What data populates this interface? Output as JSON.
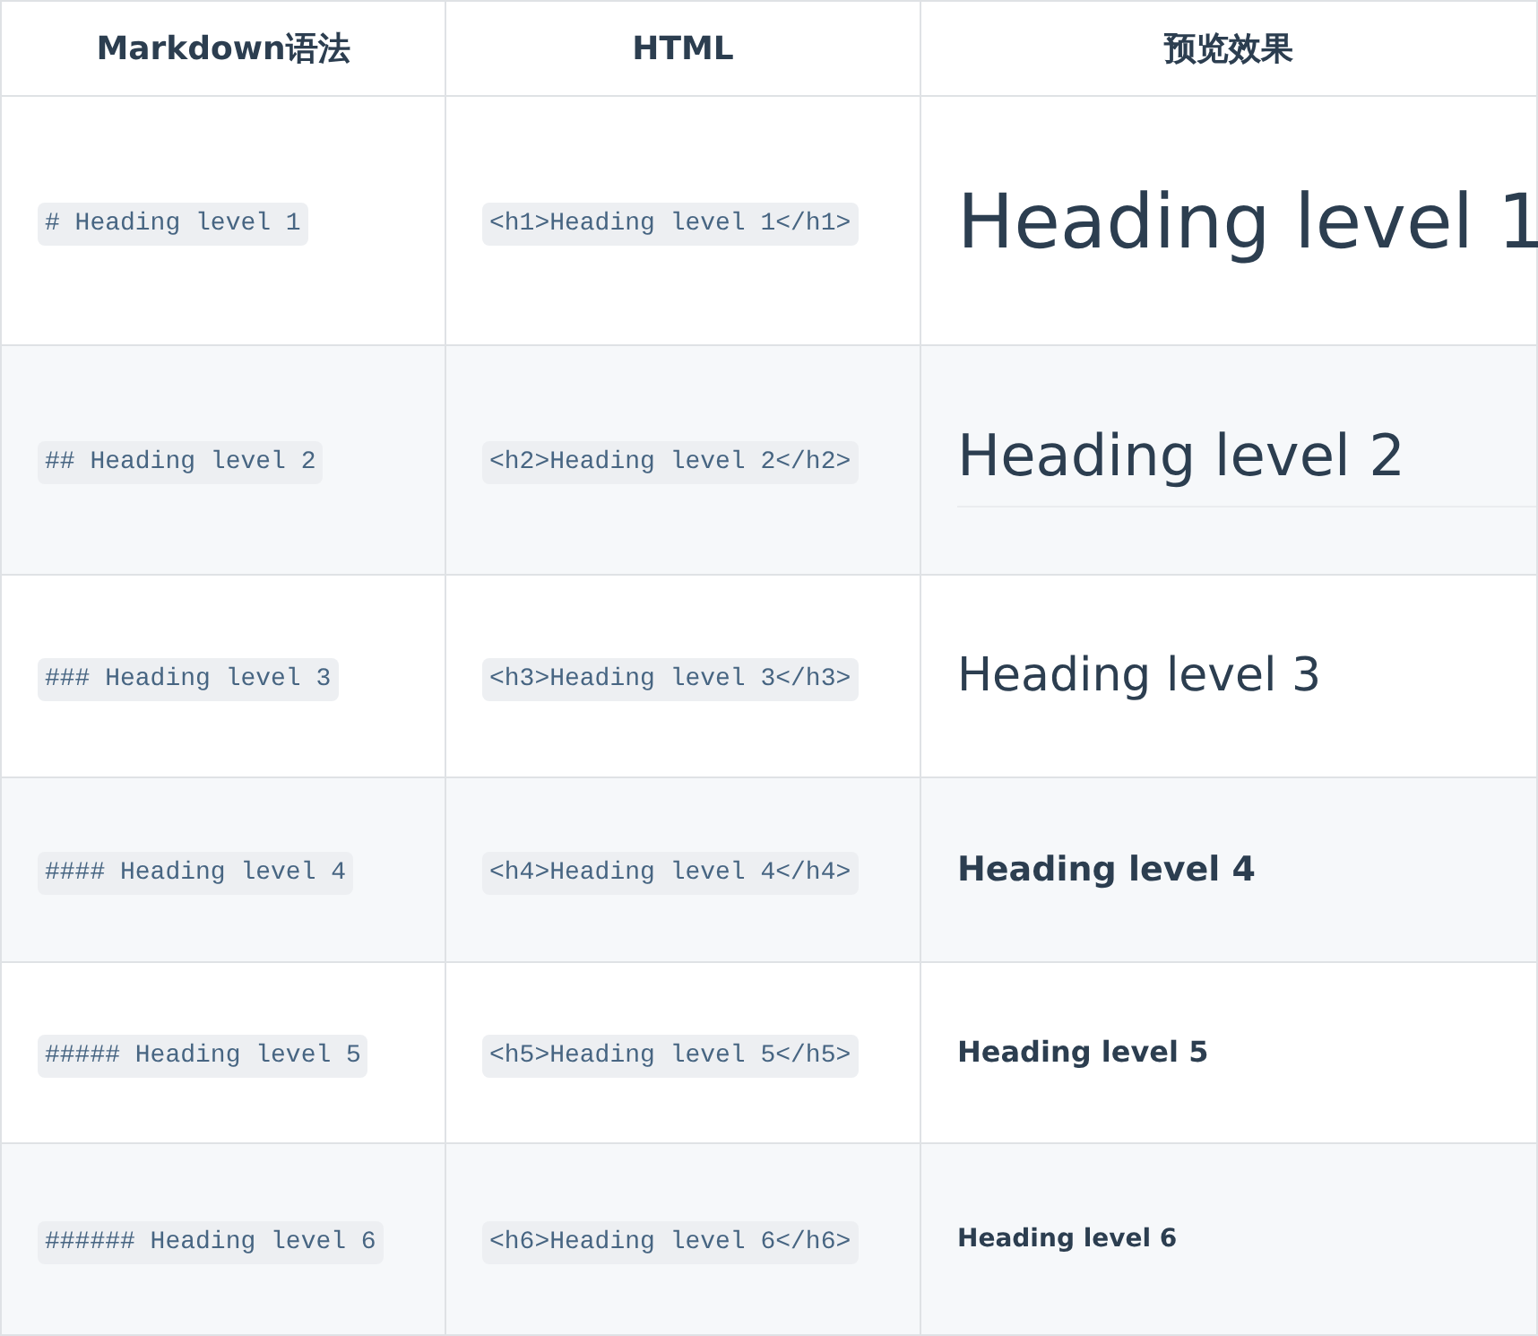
{
  "table": {
    "columns": [
      "Markdown语法",
      "HTML",
      "预览效果"
    ],
    "rows": [
      {
        "markdown": "# Heading level 1",
        "html": "<h1>Heading level 1</h1>",
        "preview": "Heading level 1",
        "kind": "h1"
      },
      {
        "markdown": "## Heading level 2",
        "html": "<h2>Heading level 2</h2>",
        "preview": "Heading level 2",
        "kind": "h2"
      },
      {
        "markdown": "### Heading level 3",
        "html": "<h3>Heading level 3</h3>",
        "preview": "Heading level 3",
        "kind": "h3"
      },
      {
        "markdown": "#### Heading level 4",
        "html": "<h4>Heading level 4</h4>",
        "preview": "Heading level 4",
        "kind": "h4"
      },
      {
        "markdown": "##### Heading level 5",
        "html": "<h5>Heading level 5</h5>",
        "preview": "Heading level 5",
        "kind": "h5"
      },
      {
        "markdown": "###### Heading level 6",
        "html": "<h6>Heading level 6</h6>",
        "preview": "Heading level 6",
        "kind": "h6"
      }
    ]
  }
}
